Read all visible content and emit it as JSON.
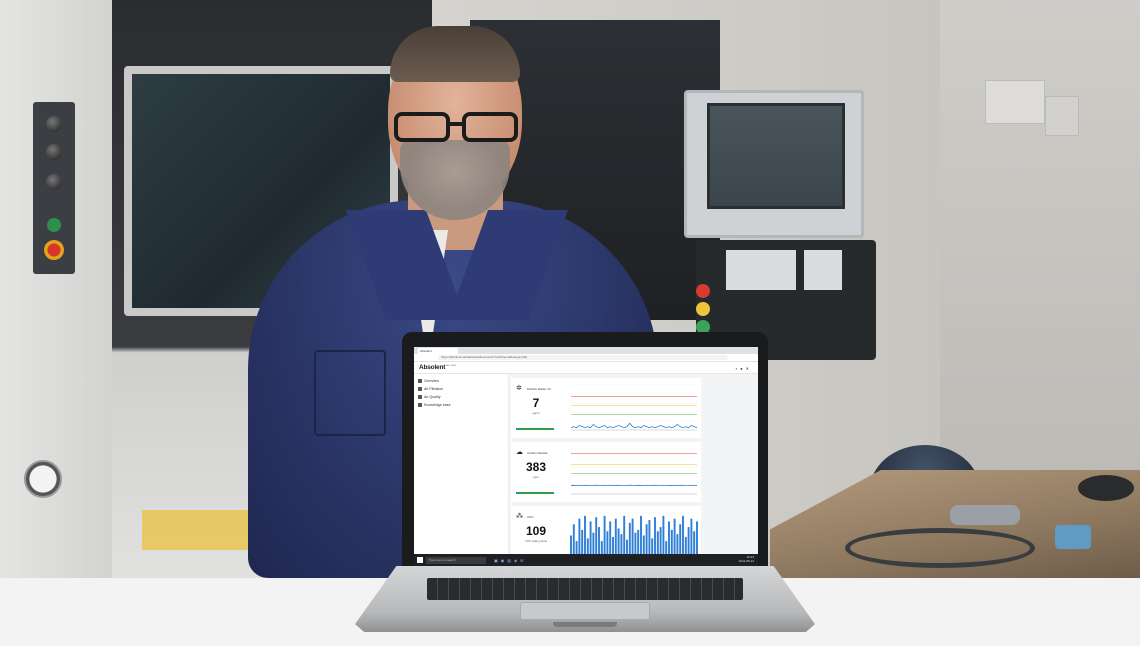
{
  "browser": {
    "tab_label": "Absolent",
    "url": "https://absolent.iot/dashboard/overview?machine=all&range=24h"
  },
  "app": {
    "logo": "Absolent",
    "logo_sub": "AIR CARE"
  },
  "sidebar": {
    "items": [
      {
        "label": "Overview",
        "icon": "grid-icon"
      },
      {
        "label": "Air Filtration",
        "icon": "fan-icon"
      },
      {
        "label": "Air Quality",
        "icon": "cloud-icon"
      },
      {
        "label": "Knowledge base",
        "icon": "book-icon"
      }
    ]
  },
  "cards": [
    {
      "title": "Particle Matter 10",
      "value": "7",
      "unit": "µg/m³",
      "icon": "particle-icon"
    },
    {
      "title": "Carbon Dioxide",
      "value": "383",
      "unit": "ppm",
      "icon": "co2-icon"
    },
    {
      "title": "VOC",
      "value": "109",
      "unit": "VOC index points",
      "icon": "voc-icon"
    }
  ],
  "taskbar": {
    "search_placeholder": "Type here to search",
    "time": "10:24",
    "date": "2021-05-12"
  },
  "colors": {
    "series": "#2f7fd6",
    "threshold_red": "#e0453a",
    "threshold_yellow": "#e7c83a",
    "threshold_green": "#4caf50",
    "status_green": "#2e9e4a"
  },
  "chart_data": [
    {
      "type": "line",
      "series": [
        {
          "values": [
            2,
            3,
            2,
            4,
            3,
            2,
            3,
            2,
            5,
            3,
            2,
            3,
            4,
            2,
            3,
            2,
            3,
            4,
            3,
            2,
            3,
            6,
            3,
            2,
            3,
            2,
            4,
            3,
            2,
            3,
            2,
            3,
            4,
            3,
            2,
            3,
            2,
            3,
            5,
            3,
            2,
            3,
            2,
            4,
            3,
            2
          ]
        }
      ],
      "ylim": [
        0,
        40
      ],
      "thresholds": [
        30,
        22,
        14
      ]
    },
    {
      "type": "line",
      "series": [
        {
          "values": [
            380,
            385,
            378,
            390,
            382,
            376,
            388,
            384,
            379,
            392,
            381,
            377,
            386,
            383,
            389,
            380,
            375,
            387,
            382,
            384,
            378,
            391,
            383,
            379,
            386,
            381,
            377,
            388,
            384,
            380,
            385,
            382,
            378,
            390,
            383,
            381,
            376,
            387,
            384,
            380,
            389,
            382,
            379,
            386,
            383,
            381
          ]
        }
      ],
      "ylim": [
        0,
        2000
      ],
      "thresholds": [
        1800,
        1300,
        900
      ]
    },
    {
      "type": "bar",
      "series": [
        {
          "values": [
            80,
            120,
            60,
            140,
            100,
            150,
            70,
            130,
            90,
            145,
            110,
            60,
            150,
            95,
            130,
            75,
            140,
            105,
            85,
            150,
            65,
            125,
            140,
            90,
            100,
            150,
            80,
            120,
            135,
            70,
            145,
            95,
            110,
            150,
            60,
            130,
            100,
            140,
            85,
            120,
            150,
            75,
            110,
            140,
            95,
            130
          ]
        }
      ],
      "ylim": [
        0,
        160
      ]
    }
  ]
}
